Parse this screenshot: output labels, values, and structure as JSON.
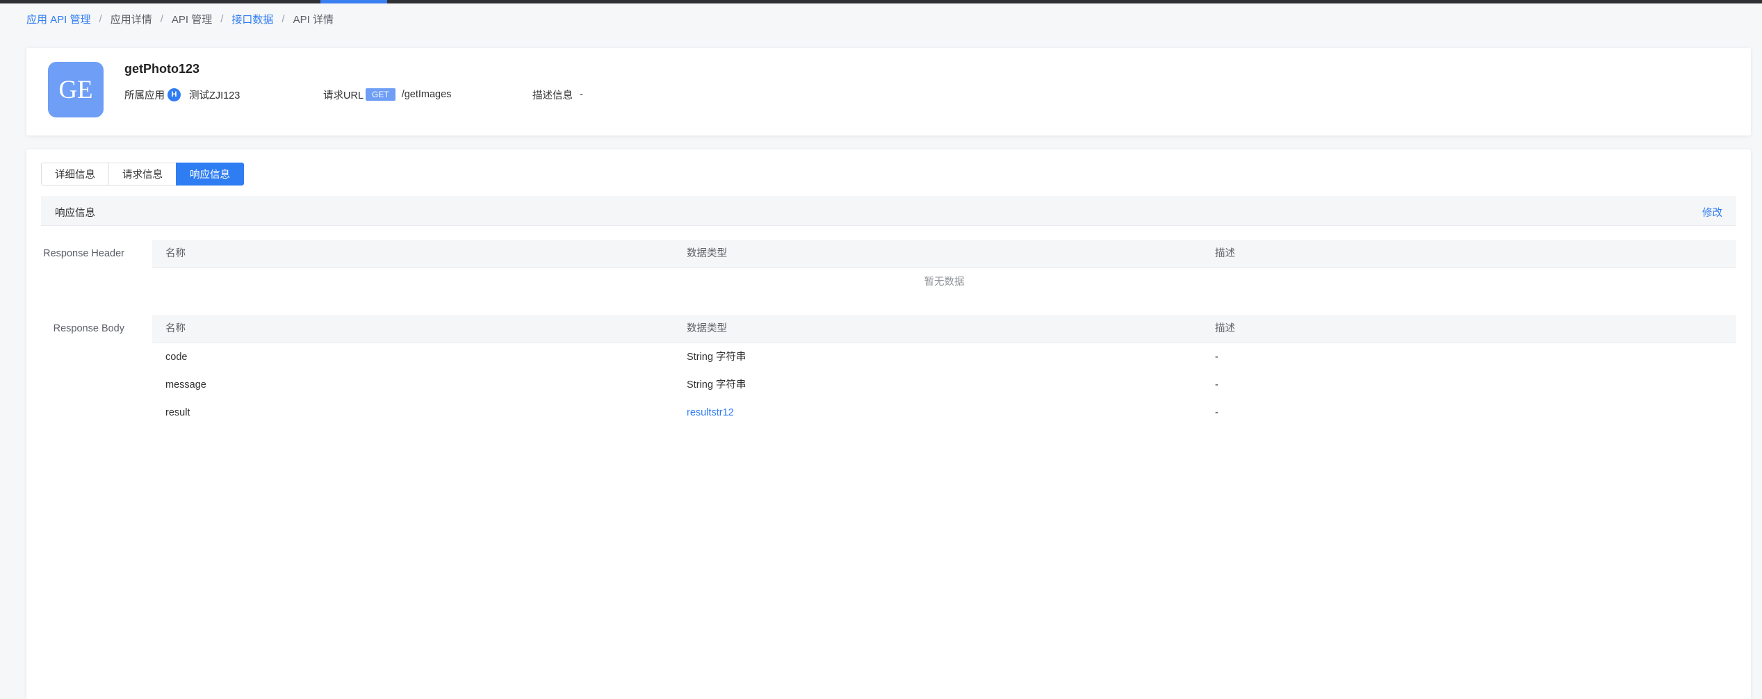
{
  "breadcrumb": [
    {
      "label": "应用 API 管理",
      "link": true
    },
    {
      "label": "应用详情",
      "link": false
    },
    {
      "label": "API 管理",
      "link": false
    },
    {
      "label": "接口数据",
      "link": true
    },
    {
      "label": "API 详情",
      "link": false
    }
  ],
  "api": {
    "avatar_text": "GE",
    "name": "getPhoto123",
    "app_label": "所属应用",
    "app_badge": "H",
    "app_name": "测试ZJI123",
    "url_label": "请求URL",
    "method": "GET",
    "path": "/getImages",
    "desc_label": "描述信息",
    "desc_value": "-"
  },
  "tabs": [
    {
      "label": "详细信息",
      "active": false
    },
    {
      "label": "请求信息",
      "active": false
    },
    {
      "label": "响应信息",
      "active": true
    }
  ],
  "section": {
    "title": "响应信息",
    "edit_label": "修改"
  },
  "response_header": {
    "label": "Response Header",
    "columns": [
      "名称",
      "数据类型",
      "描述"
    ],
    "empty_text": "暂无数据"
  },
  "response_body": {
    "label": "Response Body",
    "columns": [
      "名称",
      "数据类型",
      "描述"
    ],
    "rows": [
      {
        "name": "code",
        "type": "String 字符串",
        "desc": "-"
      },
      {
        "name": "message",
        "type": "String 字符串",
        "desc": "-"
      },
      {
        "name": "result",
        "type": "resultstr12",
        "desc": "-"
      }
    ]
  },
  "colors": {
    "accent": "#2f7df2",
    "avatar": "#6e9ef5",
    "topbar": "#2f3033"
  }
}
